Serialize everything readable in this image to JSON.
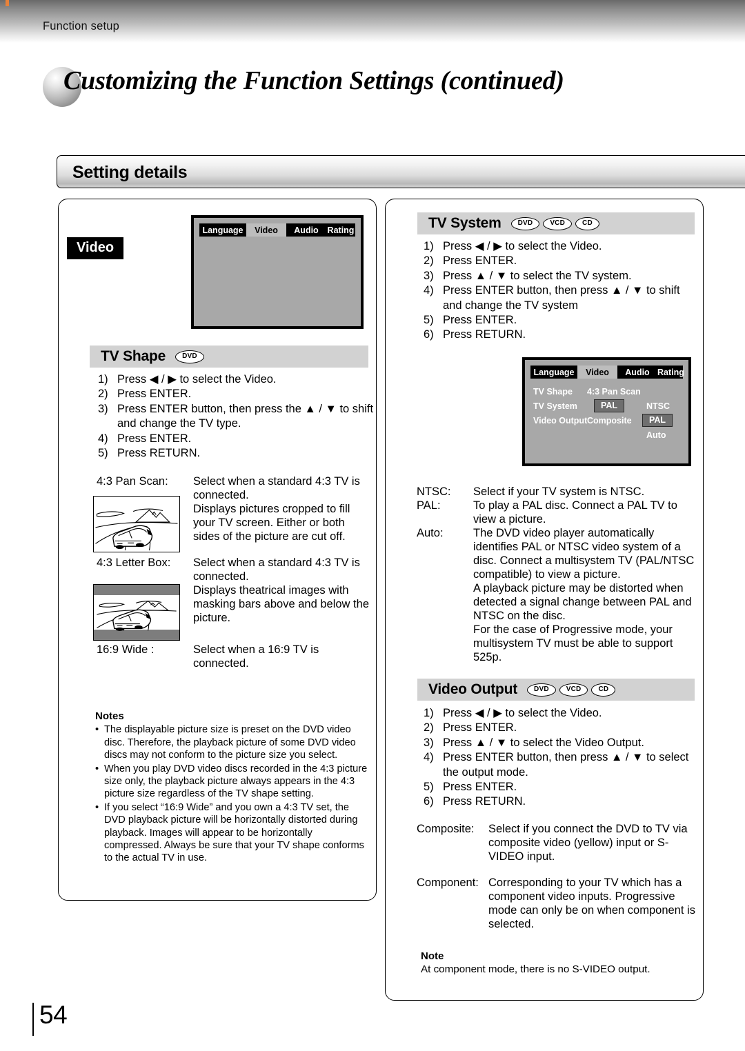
{
  "header": {
    "running_head": "Function setup",
    "chapter_title": "Customizing the Function Settings (continued)"
  },
  "section": {
    "title": "Setting details"
  },
  "left_panel": {
    "badge": "Video",
    "osd": {
      "tabs": [
        "Language",
        "Video",
        "Audio",
        "Rating"
      ],
      "selected_tab": "Video"
    },
    "tv_shape": {
      "title": "TV Shape",
      "discs": [
        "DVD"
      ],
      "steps": [
        {
          "num": "1)",
          "text": "Press ◀ / ▶  to select the Video."
        },
        {
          "num": "2)",
          "text": "Press ENTER."
        },
        {
          "num": "3)",
          "text": "Press ENTER button, then press the ▲ / ▼ to shift and change the TV type."
        },
        {
          "num": "4)",
          "text": "Press ENTER."
        },
        {
          "num": "5)",
          "text": "Press RETURN."
        }
      ],
      "options": [
        {
          "term": "4:3 Pan Scan:",
          "desc": "Select when a standard 4:3 TV is connected.\nDisplays pictures cropped to fill your TV screen.  Either or both sides of the picture are cut off."
        },
        {
          "term": "4:3 Letter Box:",
          "desc": "Select when a standard 4:3 TV is connected.\nDisplays theatrical images with masking bars above and below the picture."
        },
        {
          "term": "16:9 Wide :",
          "desc": "Select when a 16:9 TV is connected."
        }
      ]
    },
    "notes": {
      "title": "Notes",
      "bullet": "•",
      "items": [
        "The displayable picture size is preset on the DVD video disc. Therefore, the playback picture of some DVD video discs may not conform to the picture size you select.",
        "When you play DVD video discs recorded in the 4:3 picture size only, the playback picture always appears in the 4:3 picture size regardless of the TV shape setting.",
        "If you select “16:9 Wide” and you own a 4:3 TV set, the DVD playback picture will be horizontally distorted during playback. Images will appear to be horizontally compressed.  Always be sure that your TV shape conforms to the actual TV in use."
      ]
    }
  },
  "right_panel": {
    "tv_system": {
      "title": "TV System",
      "discs": [
        "DVD",
        "VCD",
        "CD"
      ],
      "steps": [
        {
          "num": "1)",
          "text": "Press ◀ / ▶  to select the Video."
        },
        {
          "num": "2)",
          "text": "Press ENTER."
        },
        {
          "num": "3)",
          "text": "Press  ▲ / ▼ to select the TV system."
        },
        {
          "num": "4)",
          "text": "Press ENTER button, then press ▲ / ▼ to shift and change the TV system"
        },
        {
          "num": "5)",
          "text": "Press ENTER."
        },
        {
          "num": "6)",
          "text": "Press RETURN."
        }
      ],
      "osd": {
        "tabs": [
          "Language",
          "Video",
          "Audio",
          "Rating"
        ],
        "selected_tab": "Video",
        "rows": [
          {
            "key": "TV Shape",
            "value_a": "4:3 Pan Scan",
            "value_a_highlight": false,
            "value_b": "",
            "value_b_highlight": false
          },
          {
            "key": "TV System",
            "value_a": "PAL",
            "value_a_highlight": true,
            "value_b": "NTSC",
            "value_b_highlight": false
          },
          {
            "key": "Video Output",
            "value_a": "Composite",
            "value_a_highlight": false,
            "value_b": "PAL",
            "value_b_highlight": true
          },
          {
            "key": "",
            "value_a": "",
            "value_a_highlight": false,
            "value_b": "Auto",
            "value_b_highlight": false
          }
        ]
      },
      "options": [
        {
          "term": "NTSC:",
          "desc": "Select if your TV system is NTSC."
        },
        {
          "term": "PAL:",
          "desc": "To play a PAL disc.  Connect a PAL TV to view a picture."
        },
        {
          "term": "Auto:",
          "desc": "The DVD video player automatically identifies PAL or NTSC video system of a disc. Connect a multisystem TV (PAL/NTSC compatible) to view a picture.\nA playback picture may be distorted when detected a signal change between PAL and NTSC on the disc.\nFor the case of Progressive mode, your multisystem TV must be able to support 525p."
        }
      ]
    },
    "video_output": {
      "title": "Video Output",
      "discs": [
        "DVD",
        "VCD",
        "CD"
      ],
      "steps": [
        {
          "num": "1)",
          "text": "Press ◀ / ▶  to select the Video."
        },
        {
          "num": "2)",
          "text": "Press ENTER."
        },
        {
          "num": "3)",
          "text": "Press  ▲ / ▼ to select the Video Output."
        },
        {
          "num": "4)",
          "text": "Press ENTER button, then press ▲ / ▼ to select the output mode."
        },
        {
          "num": "5)",
          "text": "Press ENTER."
        },
        {
          "num": "6)",
          "text": "Press RETURN."
        }
      ],
      "options": [
        {
          "term": "Composite:",
          "desc": "Select if you connect the DVD to TV via composite video (yellow) input or S-VIDEO input."
        },
        {
          "term": "Component:",
          "desc": "Corresponding to your TV which has a component video inputs. Progressive mode can only be on when component is selected."
        }
      ],
      "note": {
        "title": "Note",
        "text": "At component mode, there is no S-VIDEO output."
      }
    }
  },
  "footer": {
    "page_number": "54"
  },
  "colors": {
    "osd_background": "#a8a8a8",
    "osd_tab_bar": "#000000",
    "osd_tab_selected": "#bdbdbd",
    "subsection_header": "#d2d2d2",
    "letterbox_bar": "#7d7d7d",
    "header_accent": "#e8823a"
  }
}
